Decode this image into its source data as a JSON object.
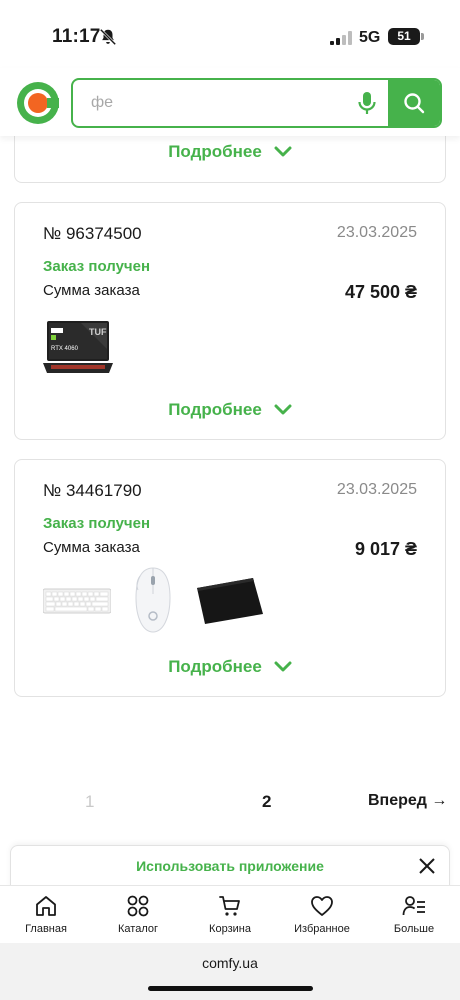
{
  "status_bar": {
    "time": "11:17",
    "network": "5G",
    "battery": "51"
  },
  "search": {
    "placeholder": "фе"
  },
  "colors": {
    "accent": "#46b24b",
    "logo_orange": "#f26522",
    "muted": "#8a8a8a"
  },
  "orders": {
    "more_label": "Подробнее",
    "items": [
      {
        "number": "№ 96374500",
        "date": "23.03.2025",
        "status": "Заказ получен",
        "sum_label": "Сумма заказа",
        "sum": "47 500 ₴",
        "thumbnails": [
          "laptop-thumbnail"
        ]
      },
      {
        "number": "№ 34461790",
        "date": "23.03.2025",
        "status": "Заказ получен",
        "sum_label": "Сумма заказа",
        "sum": "9 017 ₴",
        "thumbnails": [
          "keyboard-thumbnail",
          "mouse-thumbnail",
          "mousepad-thumbnail"
        ]
      }
    ]
  },
  "pagination": {
    "pages": [
      "1",
      "2"
    ],
    "current": "2",
    "next_label": "Вперед →"
  },
  "app_banner": {
    "text": "Использовать приложение"
  },
  "bottom_nav": [
    {
      "label": "Главная",
      "icon": "home-icon"
    },
    {
      "label": "Каталог",
      "icon": "catalog-icon"
    },
    {
      "label": "Корзина",
      "icon": "cart-icon"
    },
    {
      "label": "Избранное",
      "icon": "heart-icon"
    },
    {
      "label": "Больше",
      "icon": "more-icon"
    }
  ],
  "browser": {
    "url": "comfy.ua"
  }
}
